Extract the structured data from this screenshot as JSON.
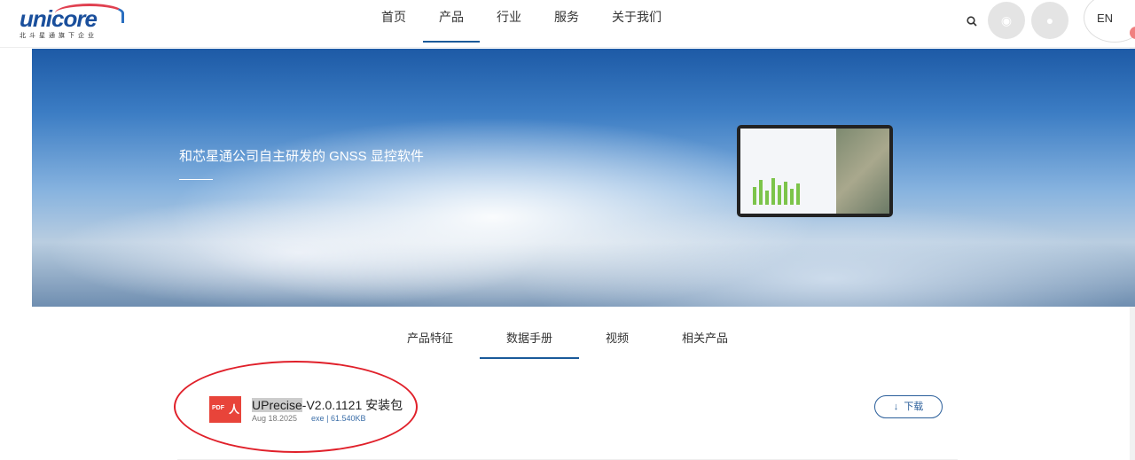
{
  "header": {
    "logo_text": "unicore",
    "logo_sub": "北斗星通旗下企业",
    "nav": [
      {
        "label": "首页"
      },
      {
        "label": "产品"
      },
      {
        "label": "行业"
      },
      {
        "label": "服务"
      },
      {
        "label": "关于我们"
      }
    ],
    "lang": "EN",
    "icons": [
      "search-icon",
      "weibo-icon",
      "wechat-icon"
    ]
  },
  "hero": {
    "title": "和芯星通公司自主研发的 GNSS 显控软件"
  },
  "tabs": [
    {
      "label": "产品特征"
    },
    {
      "label": "数据手册"
    },
    {
      "label": "视频"
    },
    {
      "label": "相关产品"
    }
  ],
  "file": {
    "name_highlight": "UPrecise",
    "name_rest": "-V2.0.1121 安装包",
    "date": "Aug 18.2025",
    "ext": "exe",
    "size": "61.540KB",
    "icon_text": "PDF",
    "download": "下载"
  },
  "colors": {
    "accent": "#1a5a9a",
    "pdf": "#e8443a",
    "annotation": "#e0202a"
  }
}
